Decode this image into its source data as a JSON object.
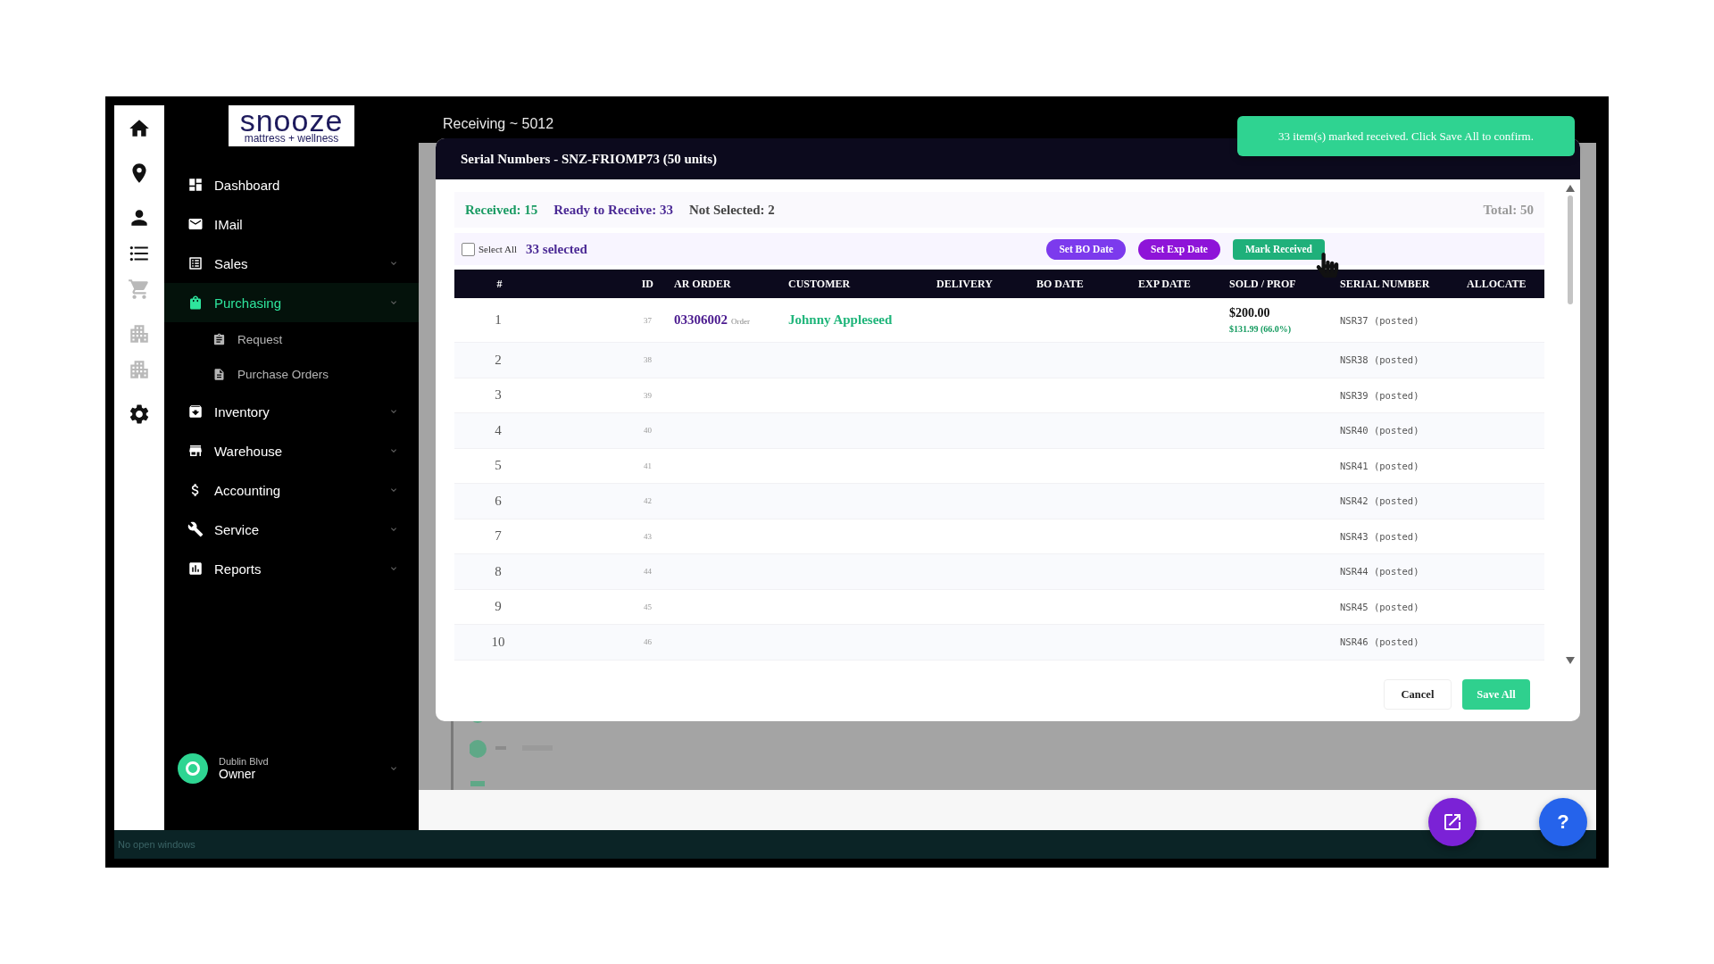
{
  "rail": [
    {
      "disabled": false
    },
    {
      "disabled": false
    },
    {
      "disabled": false
    },
    {
      "disabled": false
    },
    {
      "disabled": true
    },
    {
      "disabled": true
    },
    {
      "disabled": true
    },
    {
      "disabled": false
    }
  ],
  "logo": {
    "name": "snooze",
    "tagline": "mattress + wellness"
  },
  "nav": [
    {
      "label": "Dashboard",
      "expandable": false,
      "selected": false
    },
    {
      "label": "IMail",
      "expandable": false,
      "selected": false
    },
    {
      "label": "Sales",
      "expandable": true,
      "selected": false
    },
    {
      "label": "Purchasing",
      "expandable": true,
      "selected": true,
      "children": [
        {
          "label": "Request"
        },
        {
          "label": "Purchase Orders"
        }
      ]
    },
    {
      "label": "Inventory",
      "expandable": true,
      "selected": false
    },
    {
      "label": "Warehouse",
      "expandable": true,
      "selected": false
    },
    {
      "label": "Accounting",
      "expandable": true,
      "selected": false
    },
    {
      "label": "Service",
      "expandable": true,
      "selected": false
    },
    {
      "label": "Reports",
      "expandable": true,
      "selected": false
    }
  ],
  "user": {
    "location": "Dublin Blvd",
    "role": "Owner"
  },
  "page_title": "Receiving ~ 5012",
  "toast": "33 item(s) marked received. Click Save All to confirm.",
  "modal": {
    "title": "Serial Numbers - SNZ-FRIOMP73 (50 units)",
    "stats": [
      {
        "label": "Received: 15",
        "kind": "received"
      },
      {
        "label": "Ready to Receive: 33",
        "kind": "ready"
      },
      {
        "label": "Not Selected: 2",
        "kind": "not_selected"
      }
    ],
    "total": "Total: 50",
    "select_all": {
      "label": "Select All",
      "checked": false
    },
    "selected_count": "33 selected",
    "actions": [
      {
        "label": "Set BO Date",
        "color": "#7c3aed"
      },
      {
        "label": "Set Exp Date",
        "color": "#8e14d8"
      },
      {
        "label": "Mark Received",
        "color": "#1fb07a"
      }
    ],
    "columns": [
      "#",
      "ID",
      "AR ORDER",
      "CUSTOMER",
      "DELIVERY",
      "BO DATE",
      "EXP DATE",
      "SOLD / PROF",
      "SERIAL NUMBER",
      "ALLOCATE"
    ],
    "rows": [
      {
        "number": "1",
        "id": "37",
        "ar_order": "03306002",
        "order_tag": "Order",
        "customer": "Johnny Appleseed",
        "sold": "$200.00",
        "profit": "$131.99 (66.0%)",
        "serial": "NSR37",
        "serial_status": "(posted)"
      },
      {
        "number": "2",
        "id": "38",
        "serial": "NSR38",
        "serial_status": "(posted)"
      },
      {
        "number": "3",
        "id": "39",
        "serial": "NSR39",
        "serial_status": "(posted)"
      },
      {
        "number": "4",
        "id": "40",
        "serial": "NSR40",
        "serial_status": "(posted)"
      },
      {
        "number": "5",
        "id": "41",
        "serial": "NSR41",
        "serial_status": "(posted)"
      },
      {
        "number": "6",
        "id": "42",
        "serial": "NSR42",
        "serial_status": "(posted)"
      },
      {
        "number": "7",
        "id": "43",
        "serial": "NSR43",
        "serial_status": "(posted)"
      },
      {
        "number": "8",
        "id": "44",
        "serial": "NSR44",
        "serial_status": "(posted)"
      },
      {
        "number": "9",
        "id": "45",
        "serial": "NSR45",
        "serial_status": "(posted)"
      },
      {
        "number": "10",
        "id": "46",
        "serial": "NSR46",
        "serial_status": "(posted)"
      }
    ],
    "footer_buttons": [
      {
        "label": "Cancel",
        "kind": "secondary"
      },
      {
        "label": "Save All",
        "kind": "primary"
      }
    ]
  },
  "status_bar": "No open windows",
  "help_button": "?"
}
